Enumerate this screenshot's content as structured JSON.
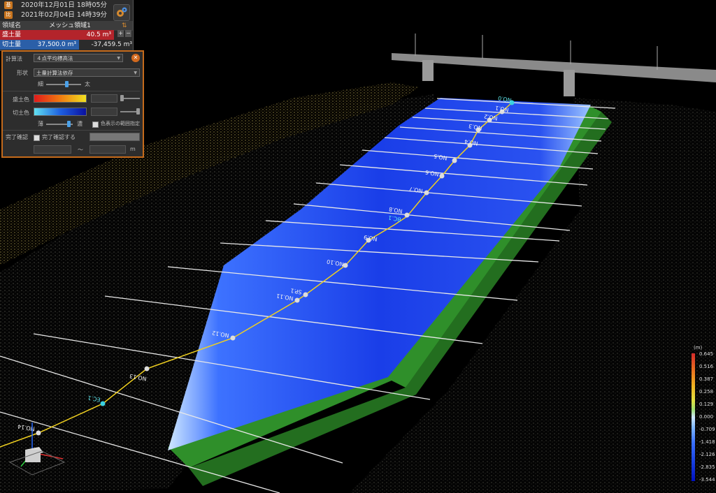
{
  "header": {
    "date1": "2020年12月01日 18時05分",
    "date2": "2021年02月04日 14時39分",
    "date1_icon": "calendar-icon",
    "date2_icon": "calendar-icon",
    "region_label": "領域名",
    "region_value": "メッシュ領域1",
    "fill_label": "盛土量",
    "fill_value": "40.5 m³",
    "cut_label": "切土量",
    "cut_value": "37,500.0 m³",
    "net_value": "-37,459.5 m³",
    "accent": "#c8741e",
    "fill_color": "#b3242b",
    "cut_color": "#2b5fa8"
  },
  "panel": {
    "calc_label": "計算法",
    "calc_value": "４点平均標高法",
    "shape_label": "形状",
    "shape_value": "土量計算法依存",
    "thin": "細",
    "thick": "太",
    "fill_color_label": "盛土色",
    "cut_color_label": "切土色",
    "light": "薄",
    "dark": "濃",
    "range_label": "色表示の範囲指定",
    "confirm_label": "完了確認",
    "confirm_check": "完了確認する",
    "tilde": "～",
    "unit": "m",
    "border_color": "#c46a1b"
  },
  "stations": [
    "NO.0",
    "NO.1",
    "NO.2",
    "NO.3",
    "NO.4",
    "NO.5",
    "NO.6",
    "NO.7",
    "NO.8",
    "BC.1",
    "NO.9",
    "NO.10",
    "SP.1",
    "NO.11",
    "NO.12",
    "NO.13",
    "EC.1",
    "NO.14"
  ],
  "legend": {
    "unit": "(m)",
    "ticks": [
      "0.645",
      "0.516",
      "0.387",
      "0.258",
      "0.129",
      "0.000",
      "-0.709",
      "-1.418",
      "-2.126",
      "-2.835",
      "-3.544"
    ]
  }
}
